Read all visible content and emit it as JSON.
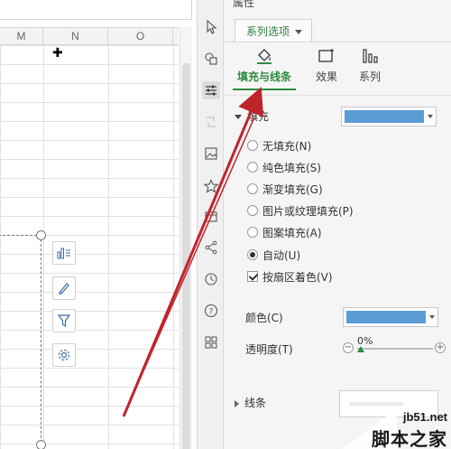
{
  "sheet": {
    "columns": [
      "M",
      "N",
      "O"
    ]
  },
  "pane": {
    "title": "属性",
    "series_tab": "系列选项",
    "sub_tabs": [
      {
        "label": "填充与线条",
        "icon": "paint-bucket-icon",
        "active": true
      },
      {
        "label": "效果",
        "icon": "effects-icon",
        "active": false
      },
      {
        "label": "系列",
        "icon": "series-bars-icon",
        "active": false
      }
    ],
    "fill": {
      "label": "填充",
      "color": "#5b9bd5",
      "options": [
        {
          "label": "无填充(N)",
          "checked": false
        },
        {
          "label": "纯色填充(S)",
          "checked": false
        },
        {
          "label": "渐变填充(G)",
          "checked": false
        },
        {
          "label": "图片或纹理填充(P)",
          "checked": false
        },
        {
          "label": "图案填充(A)",
          "checked": false
        },
        {
          "label": "自动(U)",
          "checked": true
        }
      ],
      "vary_by_sector": {
        "label": "按扇区着色(V)",
        "checked": true
      },
      "color_label": "颜色(C)",
      "transparency_label": "透明度(T)",
      "transparency_value": "0%"
    },
    "line_section": "线条"
  },
  "colors": {
    "accent": "#2d8a40",
    "fill_blue": "#5b9bd5",
    "annotation_arrow": "#c0242b"
  },
  "strip_icons": [
    "pointer-icon",
    "shapes-icon",
    "properties-icon",
    "refresh-icon",
    "picture-icon",
    "star-icon",
    "inbox-icon",
    "share-icon",
    "history-icon",
    "help-icon",
    "apps-icon"
  ],
  "floating_tools": [
    "chart-elements-icon",
    "chart-style-icon",
    "chart-filter-icon",
    "chart-settings-icon"
  ],
  "watermark": {
    "url": "jb51.net",
    "name": "脚本之家"
  }
}
